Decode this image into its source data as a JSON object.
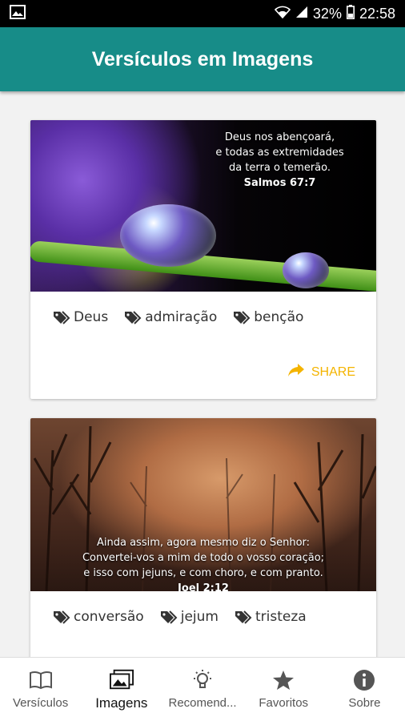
{
  "status_bar": {
    "battery": "32%",
    "time": "22:58"
  },
  "app_bar": {
    "title": "Versículos em Imagens"
  },
  "cards": [
    {
      "quote_lines": [
        "Deus nos abençoará,",
        "e todas as extremidades",
        "da terra o temerão."
      ],
      "reference": "Salmos 67:7",
      "tags": [
        "Deus",
        "admiração",
        "benção"
      ],
      "share_label": "SHARE"
    },
    {
      "quote_lines": [
        "Ainda assim, agora mesmo diz o Senhor:",
        "Convertei-vos a mim de todo o vosso coração;",
        "e isso com jejuns, e com choro, e com pranto."
      ],
      "reference": "Joel 2:12",
      "tags": [
        "conversão",
        "jejum",
        "tristeza"
      ]
    }
  ],
  "bottom_nav": [
    {
      "label": "Versículos",
      "icon": "book-icon"
    },
    {
      "label": "Imagens",
      "icon": "images-icon",
      "active": true
    },
    {
      "label": "Recomend...",
      "icon": "lightbulb-icon"
    },
    {
      "label": "Favoritos",
      "icon": "star-icon"
    },
    {
      "label": "Sobre",
      "icon": "info-icon"
    }
  ],
  "colors": {
    "primary": "#178c88",
    "accent": "#f4b400"
  }
}
